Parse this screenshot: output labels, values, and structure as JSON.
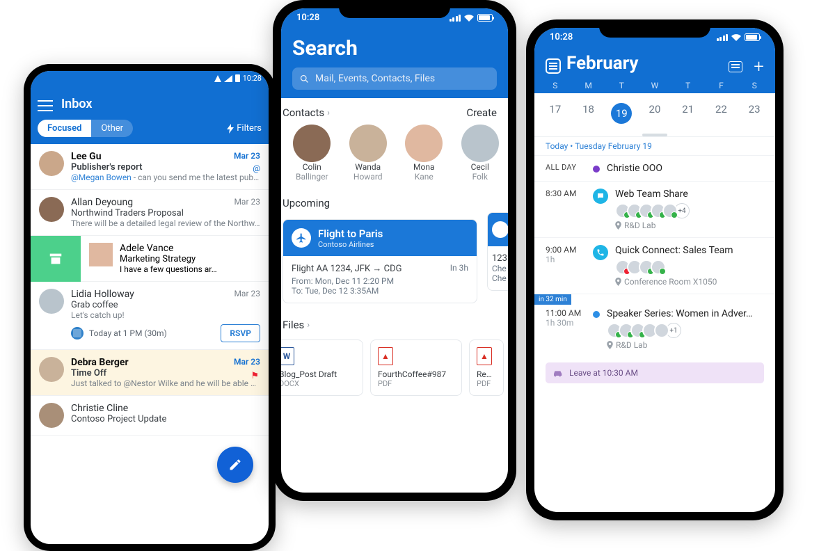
{
  "android": {
    "status_time": "10:28",
    "header_title": "Inbox",
    "tabs": {
      "focused": "Focused",
      "other": "Other",
      "filters": "Filters"
    },
    "emails": [
      {
        "sender": "Lee Gu",
        "subject": "Publisher's report",
        "preview_prefix": "@Megan Bowen",
        "preview_rest": " - can you send me the latest publi…",
        "date": "Mar 23",
        "mention": "@",
        "unread": true
      },
      {
        "sender": "Allan Deyoung",
        "subject": "Northwind Traders Proposal",
        "preview": "There will be a detailed legal review of the Northw…",
        "date": "Mar 23"
      },
      {
        "sender": "Adele Vance",
        "subject": "Marketing Strategy",
        "preview": "I have a few questions ar…",
        "archived": true
      },
      {
        "sender": "Lidia Holloway",
        "subject": "Grab coffee",
        "preview": "Let's catch up!",
        "date": "Mar 23",
        "meeting": "Today at 1 PM (30m)",
        "rsvp": "RSVP"
      },
      {
        "sender": "Debra Berger",
        "subject": "Time Off",
        "preview": "Just talked to @Nestor Wilke and he will be able …",
        "date": "Mar 23",
        "flagged": true,
        "unread": true
      },
      {
        "sender": "Christie Cline",
        "subject": "Contoso Project Update",
        "preview": "",
        "date": ""
      }
    ]
  },
  "search": {
    "status_time": "10:28",
    "title": "Search",
    "placeholder": "Mail, Events, Contacts, Files",
    "contacts_header": "Contacts",
    "create_label": "Create",
    "contacts": [
      {
        "first": "Colin",
        "last": "Ballinger"
      },
      {
        "first": "Wanda",
        "last": "Howard"
      },
      {
        "first": "Mona",
        "last": "Kane"
      },
      {
        "first": "Cecil",
        "last": "Folk"
      }
    ],
    "upcoming_header": "Upcoming",
    "flight": {
      "title": "Flight to Paris",
      "subtitle": "Contoso Airlines",
      "line1": "Flight AA 1234, JFK → CDG",
      "in": "In 3h",
      "from": "From: Mon, Dec 11 2:20 PM",
      "to": "To: Tue, Dec 12 3:35AM"
    },
    "peek": {
      "num": "123",
      "check": "Che"
    },
    "files_header": "Files",
    "files": [
      {
        "badge": "W",
        "color": "#2b579a",
        "name": "Blog_Post Draft",
        "type": "DOCX"
      },
      {
        "badge": "▲",
        "color": "#d93025",
        "name": "FourthCoffee#987",
        "type": "PDF"
      },
      {
        "badge": "▲",
        "color": "#d93025",
        "name": "Re…",
        "type": "PDF"
      }
    ]
  },
  "calendar": {
    "status_time": "10:28",
    "month": "February",
    "dow": [
      "S",
      "M",
      "T",
      "W",
      "T",
      "F",
      "S"
    ],
    "days": [
      "17",
      "18",
      "19",
      "20",
      "21",
      "22",
      "23"
    ],
    "selected_index": 2,
    "today_label": "Today • Tuesday February 19",
    "events": [
      {
        "time": "ALL DAY",
        "dur": "",
        "dot": "purple",
        "title": "Christie OOO"
      },
      {
        "time": "8:30 AM",
        "dur": "",
        "dot": "chat",
        "title": "Web Team Share",
        "attendees": 5,
        "more": "+4",
        "location": "R&D Lab"
      },
      {
        "time": "9:00 AM",
        "dur": "1h",
        "dot": "phone",
        "title": "Quick Connect: Sales Team",
        "attendees": 4,
        "location": "Conference Room X1050"
      },
      {
        "time": "11:00 AM",
        "dur": "1h 30m",
        "dot": "blue",
        "soon": "in 32 min",
        "title": "Speaker Series: Women in Adver…",
        "attendees": 5,
        "more": "+1",
        "location": "R&D Lab"
      }
    ],
    "leave": "Leave at 10:30 AM"
  }
}
